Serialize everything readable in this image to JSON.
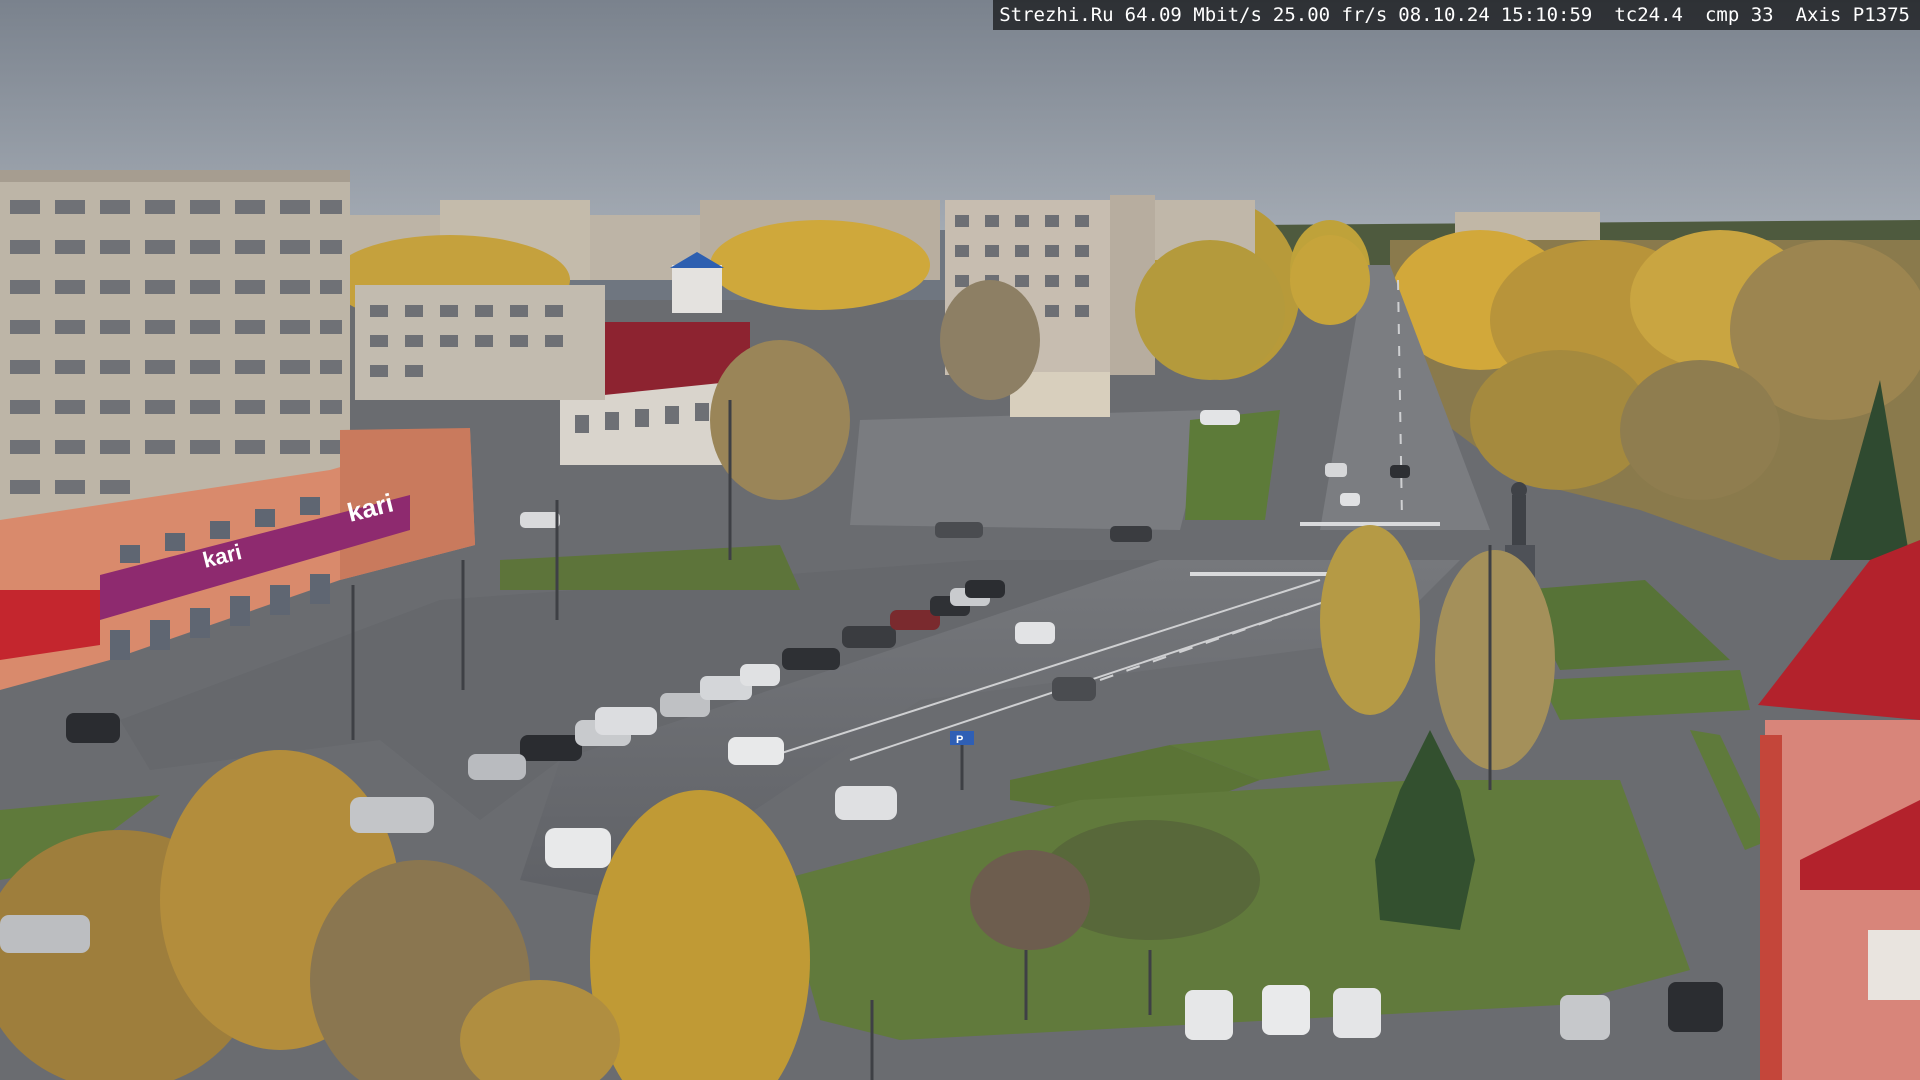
{
  "camera_overlay": {
    "site": "Strezhi.Ru",
    "bitrate": "64.09 Mbit/s",
    "framerate": "25.00 fr/s",
    "date": "08.10.24",
    "time": "15:10:59",
    "tc": "tc24.4",
    "cmp": "cmp 33",
    "camera_model": "Axis P1375"
  },
  "signs": {
    "store_logo": "kari",
    "store_logo_lower": "kari",
    "road_sign": "P"
  },
  "colors": {
    "sky": "#8a919b",
    "asphalt": "#6b6d72",
    "grass": "#5f7a3a",
    "autumn_foliage": "#c9a13a",
    "store_brand": "#8e2a6f",
    "roof_red": "#b3222c"
  }
}
